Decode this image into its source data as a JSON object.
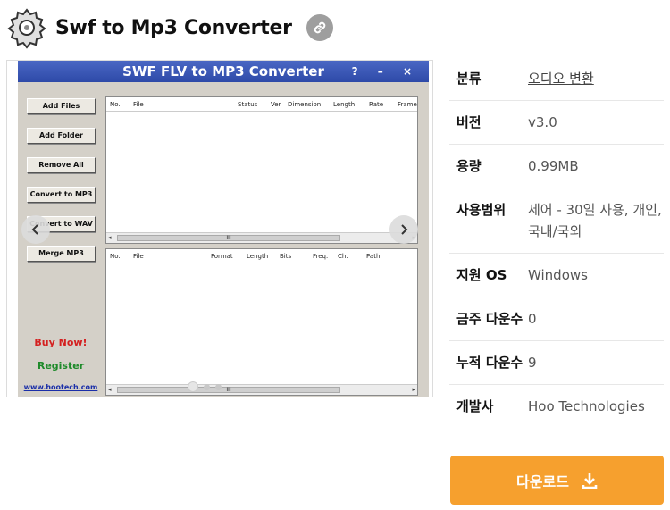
{
  "header": {
    "title": "Swf to Mp3 Converter",
    "logo_icon": "gear-logo-icon",
    "link_icon": "link-icon"
  },
  "screenshot": {
    "window_title": "SWF FLV to MP3 Converter",
    "window_controls": "? – ×",
    "side_buttons": [
      "Add Files",
      "Add Folder",
      "Remove All",
      "Convert to MP3",
      "Convert to WAV",
      "Merge MP3"
    ],
    "buy_now": "Buy Now!",
    "register": "Register",
    "website": "www.hootech.com",
    "top_columns": [
      "No.",
      "File",
      "Status",
      "Ver",
      "Dimension",
      "Length",
      "Rate",
      "Frame"
    ],
    "bottom_columns": [
      "No.",
      "File",
      "Format",
      "Length",
      "Bits",
      "Freq.",
      "Ch.",
      "Path"
    ],
    "scroll_thumb_label": "III"
  },
  "info": {
    "rows": [
      {
        "key": "분류",
        "value": "오디오 변환"
      },
      {
        "key": "버전",
        "value": "v3.0"
      },
      {
        "key": "용량",
        "value": "0.99MB"
      },
      {
        "key": "사용범위",
        "value": "세어 - 30일 사용, 개인, 국내/국외"
      },
      {
        "key": "지원 OS",
        "value": "Windows"
      },
      {
        "key": "금주 다운수",
        "value": "0"
      },
      {
        "key": "누적 다운수",
        "value": "9"
      },
      {
        "key": "개발사",
        "value": "Hoo Technologies"
      }
    ]
  },
  "download": {
    "label": "다운로드",
    "icon": "download-icon"
  },
  "colors": {
    "accent": "#f6a02e",
    "titlebar": "#2e4aa8",
    "buy_now": "#d42020",
    "register": "#1e8a2a",
    "website": "#1a2ea8"
  }
}
